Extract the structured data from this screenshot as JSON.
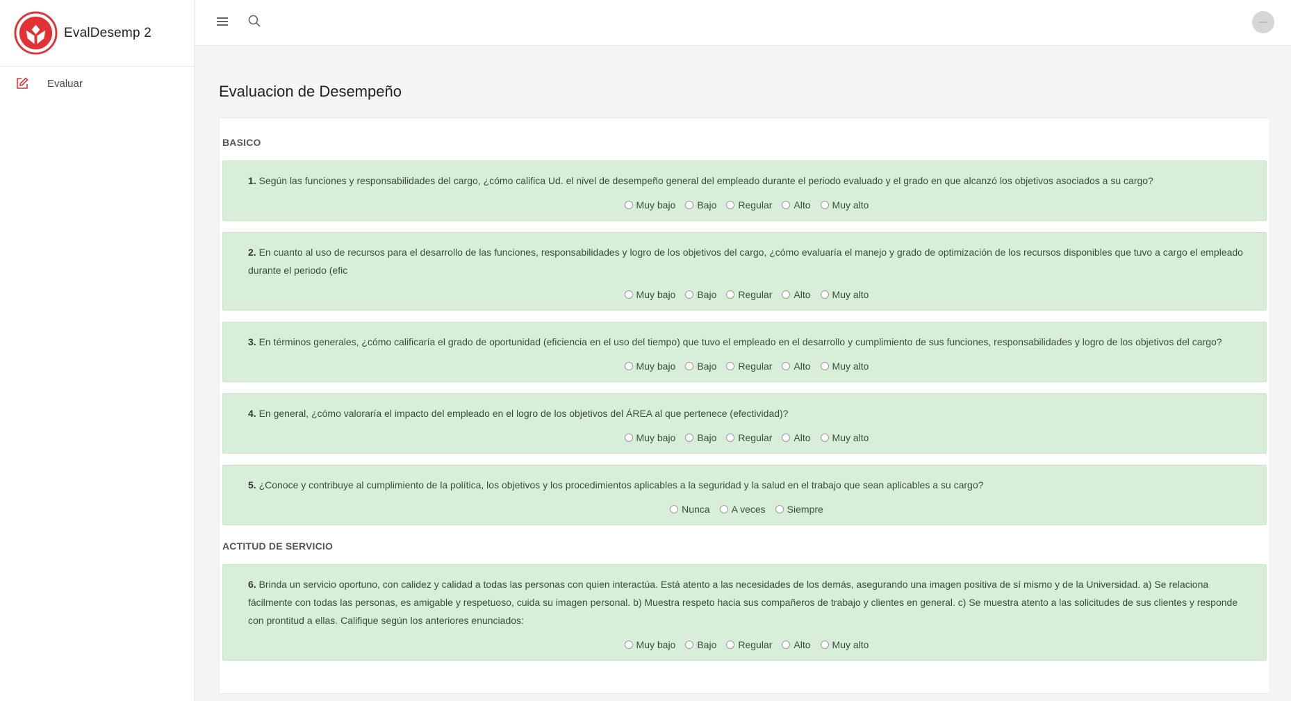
{
  "app": {
    "name": "EvalDesemp 2",
    "brand_color": "#e33236"
  },
  "sidebar": {
    "items": [
      {
        "label": "Evaluar",
        "icon": "edit-icon"
      }
    ]
  },
  "topbar": {
    "menu_icon": "hamburger-icon",
    "search_icon": "search-icon",
    "avatar_text": "---"
  },
  "page": {
    "title": "Evaluacion de Desempeño"
  },
  "sections": [
    {
      "title": "BASICO",
      "questions": [
        {
          "num": "1.",
          "text": "Según las funciones y responsabilidades del cargo, ¿cómo califica Ud. el nivel de desempeño general del empleado durante el periodo evaluado y el grado en que alcanzó los objetivos asociados a su cargo?",
          "options": [
            "Muy bajo",
            "Bajo",
            "Regular",
            "Alto",
            "Muy alto"
          ]
        },
        {
          "num": "2.",
          "text": "En cuanto al uso de recursos para el desarrollo de las funciones, responsabilidades y logro de los objetivos del cargo, ¿cómo evaluaría el manejo y grado de optimización de los recursos disponibles que tuvo a cargo el empleado durante el periodo (efic",
          "options": [
            "Muy bajo",
            "Bajo",
            "Regular",
            "Alto",
            "Muy alto"
          ]
        },
        {
          "num": "3.",
          "text": "En términos generales, ¿cómo calificaría el grado de oportunidad (eficiencia en el uso del tiempo) que tuvo el empleado en el desarrollo y cumplimiento de sus funciones, responsabilidades y logro de los objetivos del cargo?",
          "options": [
            "Muy bajo",
            "Bajo",
            "Regular",
            "Alto",
            "Muy alto"
          ]
        },
        {
          "num": "4.",
          "text": "En general, ¿cómo valoraría el impacto del empleado en el logro de los objetivos del ÁREA al que pertenece (efectividad)?",
          "options": [
            "Muy bajo",
            "Bajo",
            "Regular",
            "Alto",
            "Muy alto"
          ]
        },
        {
          "num": "5.",
          "text": "¿Conoce y contribuye al cumplimiento de la política, los objetivos y los procedimientos aplicables a la seguridad y la salud en el trabajo que sean aplicables a su cargo?",
          "options": [
            "Nunca",
            "A veces",
            "Siempre"
          ]
        }
      ]
    },
    {
      "title": "ACTITUD DE SERVICIO",
      "questions": [
        {
          "num": "6.",
          "text": "Brinda un servicio oportuno, con calidez y calidad a todas las personas con quien interactúa. Está atento a las necesidades de los demás, asegurando una imagen positiva de sí mismo y de la Universidad. a) Se relaciona fácilmente con todas las personas, es amigable y respetuoso, cuida su imagen personal. b) Muestra respeto hacia sus compañeros de trabajo y clientes en general. c) Se muestra atento a las solicitudes de sus clientes y responde con prontitud a ellas. Califique según los anteriores enunciados:",
          "options": [
            "Muy bajo",
            "Bajo",
            "Regular",
            "Alto",
            "Muy alto"
          ]
        }
      ]
    }
  ]
}
